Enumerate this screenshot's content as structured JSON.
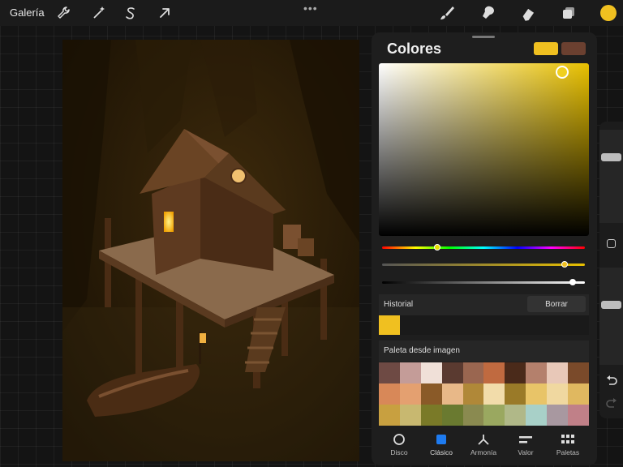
{
  "topbar": {
    "gallery_label": "Galería",
    "left_tools": [
      "wrench-icon",
      "magic-wand-icon",
      "selection-icon",
      "transform-arrow-icon"
    ],
    "right_tools": [
      "brush-icon",
      "smudge-icon",
      "eraser-icon",
      "layers-icon"
    ],
    "menu_dots": "•••",
    "current_color": "#f0c020"
  },
  "panel": {
    "title": "Colores",
    "current_swatch": "#f0c020",
    "previous_swatch": "#6b4030",
    "history_label": "Historial",
    "clear_label": "Borrar",
    "history_colors": [
      "#f0c020"
    ],
    "palette_label": "Paleta desde imagen",
    "palette_colors": [
      "#6e4a44",
      "#c49c98",
      "#f0e0d8",
      "#5a3a30",
      "#9a6650",
      "#c06a40",
      "#4a2a1a",
      "#b4806c",
      "#e8c8b8",
      "#7a4a2a",
      "#d88858",
      "#e4a070",
      "#8a5a28",
      "#e8b888",
      "#b08838",
      "#f2dcaa",
      "#9a7a28",
      "#e8c468",
      "#f0d8a0",
      "#e0b860",
      "#c8a040",
      "#c8b870",
      "#7a7a28",
      "#6a7a30",
      "#8a8a50",
      "#9aa860",
      "#b0b888",
      "#a8d0c8",
      "#a898a0",
      "#c08088"
    ],
    "tabs": [
      {
        "label": "Disco",
        "icon": "disc-icon"
      },
      {
        "label": "Clásico",
        "icon": "classic-square-icon"
      },
      {
        "label": "Armonía",
        "icon": "harmony-icon"
      },
      {
        "label": "Valor",
        "icon": "value-sliders-icon"
      },
      {
        "label": "Paletas",
        "icon": "palettes-grid-icon"
      }
    ],
    "active_tab": "Clásico",
    "sliders": {
      "hue": 0.27,
      "saturation": 0.9,
      "brightness": 0.94
    }
  },
  "sidebar": {
    "brush_size": 0.15,
    "opacity": 0.25
  }
}
